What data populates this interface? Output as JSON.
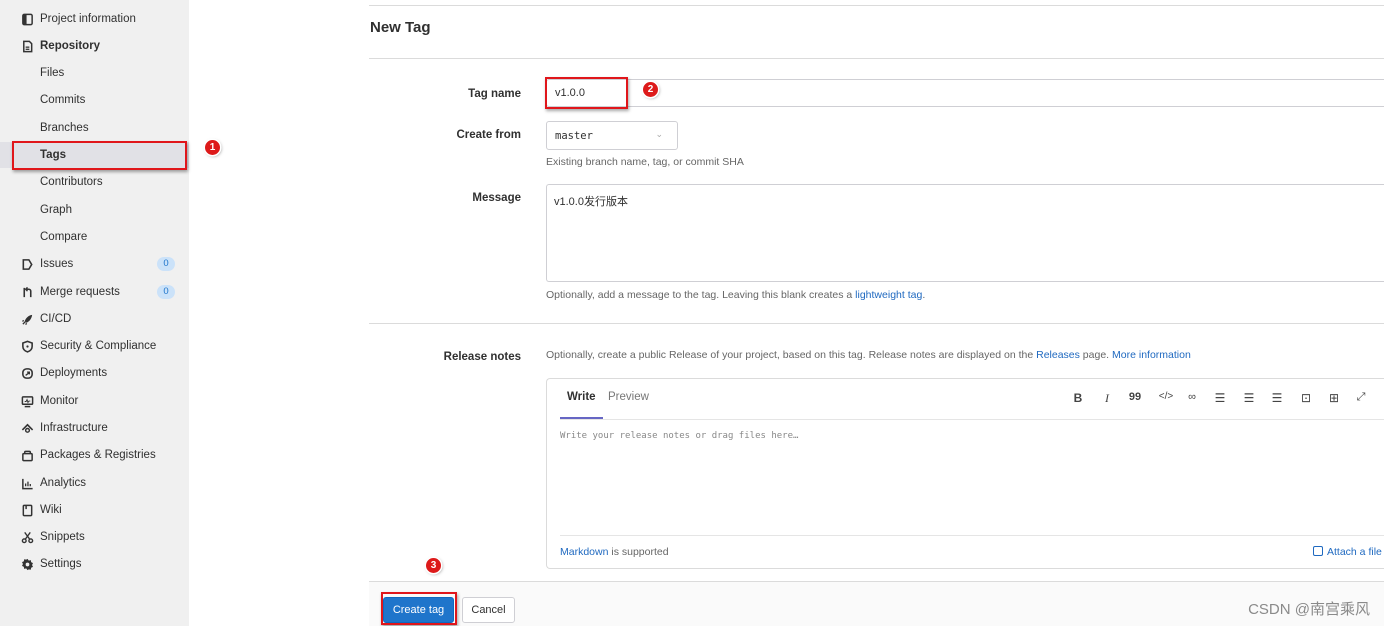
{
  "sidebar": {
    "items": [
      {
        "label": "Project information",
        "icon": "project-icon"
      },
      {
        "label": "Repository",
        "icon": "document-icon",
        "bold": true
      },
      {
        "label": "Files",
        "sub": true
      },
      {
        "label": "Commits",
        "sub": true
      },
      {
        "label": "Branches",
        "sub": true
      },
      {
        "label": "Tags",
        "sub": true,
        "active": true
      },
      {
        "label": "Contributors",
        "sub": true
      },
      {
        "label": "Graph",
        "sub": true
      },
      {
        "label": "Compare",
        "sub": true
      },
      {
        "label": "Issues",
        "icon": "issues-icon",
        "badge": "0"
      },
      {
        "label": "Merge requests",
        "icon": "merge-request-icon",
        "badge": "0"
      },
      {
        "label": "CI/CD",
        "icon": "rocket-icon"
      },
      {
        "label": "Security & Compliance",
        "icon": "shield-icon"
      },
      {
        "label": "Deployments",
        "icon": "deployments-icon"
      },
      {
        "label": "Monitor",
        "icon": "monitor-icon"
      },
      {
        "label": "Infrastructure",
        "icon": "cloud-icon"
      },
      {
        "label": "Packages & Registries",
        "icon": "package-icon"
      },
      {
        "label": "Analytics",
        "icon": "chart-icon"
      },
      {
        "label": "Wiki",
        "icon": "book-icon"
      },
      {
        "label": "Snippets",
        "icon": "scissors-icon"
      },
      {
        "label": "Settings",
        "icon": "gear-icon"
      }
    ]
  },
  "annotations": {
    "step1": "1",
    "step2": "2",
    "step3": "3",
    "highlight_color": "#e0161b"
  },
  "form": {
    "title": "New Tag",
    "tag_name": {
      "label": "Tag name",
      "value": "v1.0.0"
    },
    "create_from": {
      "label": "Create from",
      "value": "master",
      "help": "Existing branch name, tag, or commit SHA"
    },
    "message": {
      "label": "Message",
      "value": "v1.0.0发行版本",
      "help_prefix": "Optionally, add a message to the tag. Leaving this blank creates a ",
      "help_link": "lightweight tag",
      "help_suffix": "."
    },
    "release_notes": {
      "label": "Release notes",
      "help_prefix": "Optionally, create a public Release of your project, based on this tag. Release notes are displayed on the ",
      "help_link1": "Releases",
      "help_middle": " page. ",
      "help_link2": "More information",
      "tab_write": "Write",
      "tab_preview": "Preview",
      "placeholder": "Write your release notes or drag files here…",
      "markdown_link": "Markdown",
      "markdown_suffix": " is supported",
      "attach_label": "Attach a file",
      "toolbar": {
        "bold": "B",
        "italic": "I",
        "quote": "99",
        "code": "</>",
        "link": "🔗",
        "bullet_list": "☰",
        "numbered_list": "☰",
        "task_list": "☰",
        "collapsible": "⊡",
        "table": "⊞",
        "fullscreen": "⤢"
      }
    },
    "buttons": {
      "create": "Create tag",
      "cancel": "Cancel"
    }
  },
  "watermark": "CSDN @南宫乘风",
  "colors": {
    "primary": "#1f75cb",
    "link": "#1f69c0",
    "sidebar_bg": "#f0f0f0",
    "tab_underline": "#6666c4"
  }
}
